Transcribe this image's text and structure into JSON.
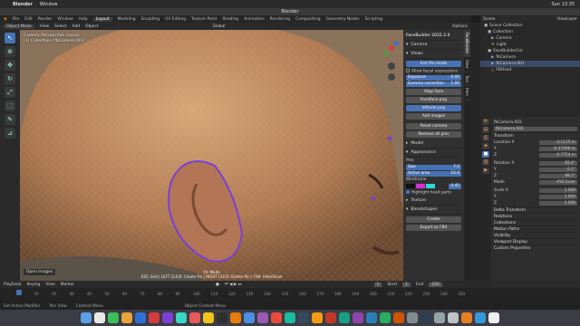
{
  "macbar": {
    "app": "Blender",
    "menu": [
      "Window"
    ],
    "clock": "Sun 13:35"
  },
  "window": {
    "title": "Blender"
  },
  "topmenu": [
    "File",
    "Edit",
    "Render",
    "Window",
    "Help"
  ],
  "workspaces": [
    "Layout",
    "Modeling",
    "Sculpting",
    "UV Editing",
    "Texture Paint",
    "Shading",
    "Animation",
    "Rendering",
    "Compositing",
    "Geometry Nodes",
    "Scripting"
  ],
  "scene": {
    "scene_label": "Scene",
    "view_layer": "ViewLayer"
  },
  "viewport": {
    "mode": "Object Mode",
    "menus": [
      "View",
      "Select",
      "Add",
      "Object"
    ],
    "orientation": "Global",
    "options": "Options",
    "info_line1": "Camera Perspective (Local)",
    "info_line2": "(1) Collection | fbCamera.001",
    "open_images": "Open Images",
    "pin_mode": "Pin Mode",
    "pin_help": "ESC: Exit | LEFT CLICK: Create Pin | RIGHT CLICK: Delete Pin | TAB: Hide/Show"
  },
  "npanel": {
    "title": "FaceBuilder 2022.2.0",
    "camera": "Camera",
    "views": "Views",
    "exit_pin": "Exit Pin mode",
    "allow_expr": "Allow facial expressions",
    "exposure": "Exposure",
    "exposure_val": "0.00",
    "gamma": "Gamma correction",
    "gamma_val": "1.00",
    "align_face": "Align face",
    "img1": "frontface.png",
    "img2": "leftside.png",
    "add_images": "Add images",
    "reset_camera": "Reset camera",
    "remove_pins": "Remove all pins",
    "model": "Model",
    "appearance": "Appearance",
    "pins": "Pins",
    "pin_size": "Size",
    "pin_size_val": "7.0",
    "active_area": "Active area",
    "active_area_val": "16.0",
    "wireframe": "Wireframe",
    "wire_val": "0.45",
    "highlight": "Highlight head parts",
    "texture": "Texture",
    "blendshapes": "Blendshapes",
    "create": "Create",
    "export_fbx": "Export as FBX",
    "tabs": [
      "FaceBuilder",
      "View",
      "Tool",
      "Item"
    ]
  },
  "outliner": {
    "items": [
      {
        "label": "Scene Collection",
        "sel": false
      },
      {
        "label": "Collection",
        "sel": false
      },
      {
        "label": "Camera",
        "sel": false
      },
      {
        "label": "Light",
        "sel": false
      },
      {
        "label": "FaceBuilderCol",
        "sel": false
      },
      {
        "label": "fbCamera",
        "sel": false
      },
      {
        "label": "fbCamera.001",
        "sel": true
      },
      {
        "label": "FBHead",
        "sel": false
      }
    ]
  },
  "properties": {
    "object": "fbCamera.003",
    "object_field": "fbCamera.003",
    "transform": "Transform",
    "loc": [
      "4.1115 m",
      "-0.27006 m",
      "0.7754 m"
    ],
    "rot": [
      "83.6°",
      "0.1°",
      "88.5°"
    ],
    "mode": "XYZ Euler",
    "scale": [
      "1.000",
      "1.000",
      "1.000"
    ],
    "labels": {
      "loc": "Location X",
      "rot": "Rotation X",
      "mode": "Mode",
      "scale": "Scale X",
      "y": "Y",
      "z": "Z"
    },
    "sections": [
      "Delta Transform",
      "Relations",
      "Collections",
      "Motion Paths",
      "Visibility",
      "Viewport Display",
      "Custom Properties"
    ]
  },
  "timeline": {
    "menus": [
      "Playback",
      "Keying",
      "View",
      "Marker"
    ],
    "start_label": "Start",
    "start": "1",
    "end_label": "End",
    "end": "250",
    "current": "1",
    "ticks": [
      "0",
      "10",
      "20",
      "30",
      "40",
      "50",
      "60",
      "70",
      "80",
      "90",
      "100",
      "110",
      "120",
      "130",
      "140",
      "150",
      "160",
      "170",
      "180",
      "190",
      "200",
      "210",
      "220",
      "230",
      "240",
      "250"
    ]
  },
  "status": {
    "items": [
      "Set Active Modifier",
      "Pan View",
      "Context Menu"
    ],
    "object_mode": "Object Context Menu"
  }
}
